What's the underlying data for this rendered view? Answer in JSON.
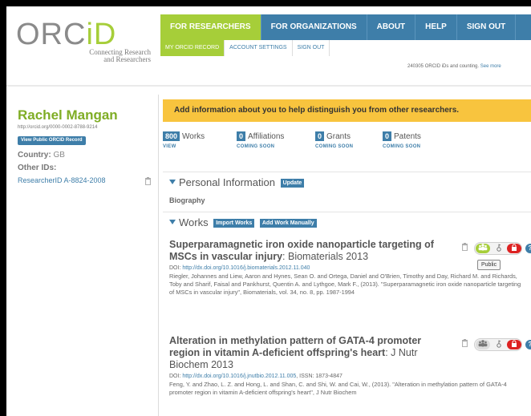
{
  "logo": {
    "text_main": "ORC",
    "text_id": "iD",
    "tagline_1": "Connecting Research",
    "tagline_2": "and Researchers"
  },
  "nav": {
    "items": [
      "FOR RESEARCHERS",
      "FOR ORGANIZATIONS",
      "ABOUT",
      "HELP",
      "SIGN OUT"
    ],
    "active": "FOR RESEARCHERS"
  },
  "subnav": {
    "items": [
      "MY ORCID RECORD",
      "ACCOUNT SETTINGS",
      "SIGN OUT"
    ],
    "active": "MY ORCID RECORD"
  },
  "counter": {
    "text": "240305 ORCID iDs and counting.",
    "link": "See more"
  },
  "sidebar": {
    "name": "Rachel Mangan",
    "orcid_url": "http://orcid.org/0000-0002-8788-9214",
    "public_button": "View Public ORCID Record",
    "country_label": "Country:",
    "country_value": "GB",
    "other_ids_label": "Other IDs:",
    "researcher_id": "ResearcherID A-8824-2008"
  },
  "main": {
    "alert": "Add information about you to help distinguish you from other researchers.",
    "stats": [
      {
        "count": "800",
        "label": "Works",
        "sub": "VIEW"
      },
      {
        "count": "0",
        "label": "Affiliations",
        "sub": "COMING SOON"
      },
      {
        "count": "0",
        "label": "Grants",
        "sub": "COMING SOON"
      },
      {
        "count": "0",
        "label": "Patents",
        "sub": "COMING SOON"
      }
    ],
    "personal": {
      "title": "Personal Information",
      "button": "Update"
    },
    "biography": "Biography",
    "works_section": {
      "title": "Works",
      "import_button": "Import Works",
      "add_button": "Add Work Manually"
    },
    "works": [
      {
        "title": "Superparamagnetic iron oxide nanoparticle targeting of MSCs in vascular injury",
        "journal": ": Biomaterials 2013",
        "doi_label": "DOI:",
        "doi_url": "http://dx.doi.org/10.1016/j.biomaterials.2012.11.040",
        "issn": "",
        "citation": "Riegler, Johannes and Liew, Aaron and Hynes, Sean O. and Ortega, Daniel and O'Brien, Timothy and Day, Richard M. and Richards, Toby and Sharif, Faisal and Pankhurst, Quentin A. and Lythgoe, Mark F., (2013). \"Superparamagnetic iron oxide nanoparticle targeting of MSCs in vascular injury\", Biomaterials, vol. 34, no. 8, pp. 1987-1994"
      },
      {
        "title": "Alteration in methylation pattern of GATA-4 promoter region in vitamin A-deficient offspring's heart",
        "journal": ": J Nutr Biochem 2013",
        "doi_label": "DOI:",
        "doi_url": "http://dx.doi.org/10.1016/j.jnutbio.2012.11.005",
        "issn": ", ISSN: 1873-4847",
        "citation": "Feng, Y. and Zhao, L. Z. and Hong, L. and Shan, C. and Shi, W. and Cai, W., (2013). \"Alteration in methylation pattern of GATA-4 promoter region in vitamin A-deficient offspring's heart\", J Nutr Biochem"
      }
    ],
    "tooltip": "Public"
  },
  "colors": {
    "orcid_green": "#a6ce39",
    "orcid_blue": "#3e7ea9",
    "alert_yellow": "#f8c43e",
    "private_red": "#dd2222"
  }
}
